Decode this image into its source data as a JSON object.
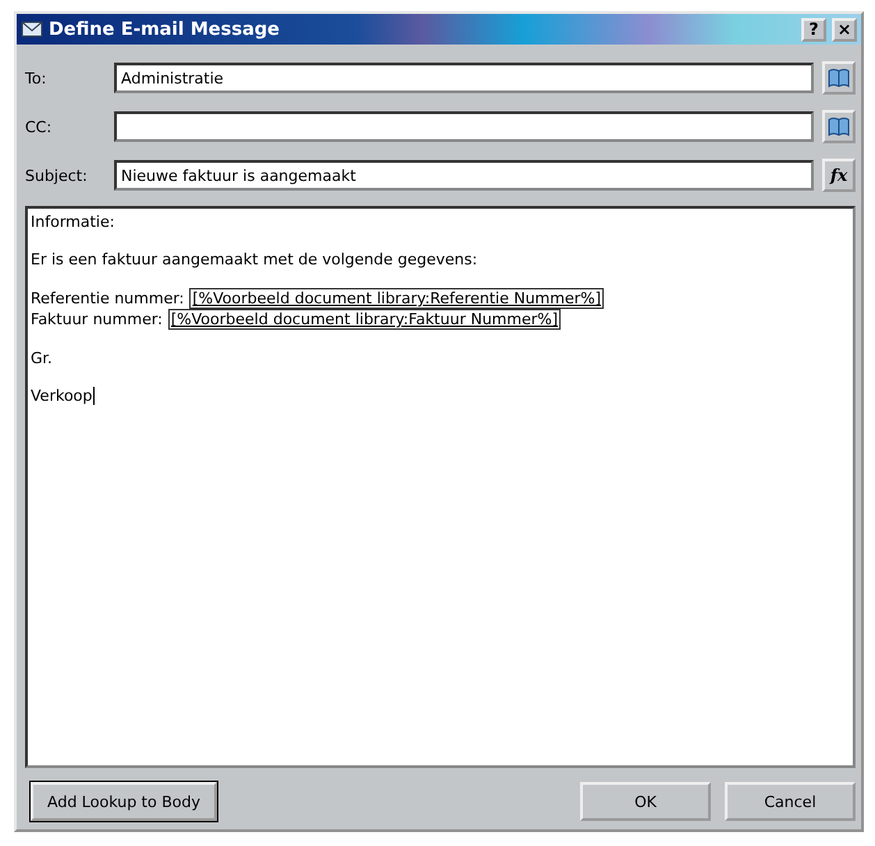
{
  "window": {
    "title": "Define E-mail Message",
    "buttons": [
      "?",
      "×"
    ]
  },
  "fields": [
    {
      "label": "To:",
      "value": "Administratie",
      "kind": "book"
    },
    {
      "label": "CC:",
      "kind": "book"
    },
    {
      "label": "Subject:",
      "value": "Nieuwe faktuur is aangemaakt",
      "kind": "fx",
      "button": "fx"
    }
  ],
  "body": {
    "paragraphs": [
      {
        "lines": [
          {
            "segments": [
              {
                "text": "Informatie:",
                "kind": "plain"
              }
            ]
          }
        ]
      },
      {
        "lines": [
          {
            "segments": [
              {
                "text": "Er is een faktuur aangemaakt met de volgende gegevens:",
                "kind": "plain"
              }
            ]
          }
        ]
      },
      {
        "lines": [
          {
            "segments": [
              {
                "text": "Referentie nummer:",
                "kind": "plain"
              },
              {
                "text": "[%Voorbeeld document library:Referentie Nummer%]",
                "kind": "lookup"
              }
            ]
          },
          {
            "segments": [
              {
                "text": "Faktuur nummer:",
                "kind": "plain"
              },
              {
                "text": "[%Voorbeeld document library:Faktuur Nummer%]",
                "kind": "lookup"
              }
            ]
          }
        ]
      },
      {
        "lines": [
          {
            "segments": [
              {
                "text": "Gr.",
                "kind": "plain"
              }
            ]
          }
        ]
      },
      {
        "lines": [
          {
            "segments": [
              {
                "text": "Verkoop",
                "kind": "plain"
              }
            ],
            "caret": true
          }
        ]
      }
    ]
  },
  "buttons": [
    {
      "label": "Add Lookup to Body",
      "kind": "tool"
    },
    {
      "label": "OK",
      "kind": "dialog"
    },
    {
      "label": "Cancel",
      "kind": "dialog"
    }
  ]
}
